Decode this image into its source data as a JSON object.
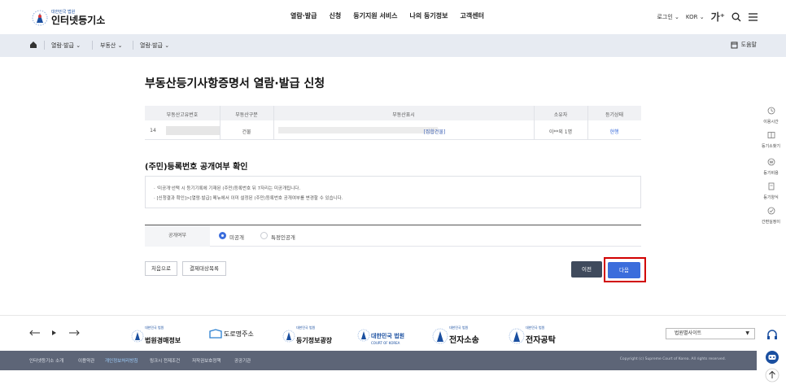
{
  "header": {
    "logo_small": "대한민국 법원",
    "logo_big": "인터넷등기소",
    "nav": [
      "열람·발급",
      "신청",
      "등기지원 서비스",
      "나의 등기정보",
      "고객센터"
    ],
    "login": "로그인",
    "lang": "KOR",
    "font_size": "가⁺"
  },
  "breadcrumb": {
    "items": [
      "열람·발급",
      "부동산",
      "열람·발급"
    ],
    "help": "도움말"
  },
  "page_title": "부동산등기사항증명서 열람·발급 신청",
  "table": {
    "headers": [
      "부동산고유번호",
      "부동산구분",
      "부동산표시",
      "소유자",
      "등기상태"
    ],
    "row": {
      "id_prefix": "14",
      "type": "건물",
      "address": "[집합건물]",
      "owner": "이**외 1명",
      "status": "현행"
    }
  },
  "section2_title": "(주민)등록번호 공개여부 확인",
  "notice": [
    "· '미공개'선택 시 등기기록에 기재된 (주민)등록번호 뒤 7자리는 미공개됩니다.",
    "· [신청결과 확인]>[열람·발급] 메뉴에서 이미 설정된 (주민)등록번호 공개여부를 변경할 수 있습니다."
  ],
  "disclosure": {
    "label": "공개여부",
    "options": [
      "미공개",
      "특정인공개"
    ],
    "selected": "미공개"
  },
  "buttons": {
    "first": "처음으로",
    "list": "결제대상목록",
    "prev": "이전",
    "next": "다음"
  },
  "quick_menu": [
    "이용시간",
    "등기소찾기",
    "등기비용",
    "등기양식",
    "간편실정이"
  ],
  "footer_links": [
    {
      "small": "대한민국 법원",
      "title": "법원경매정보"
    },
    {
      "small": "",
      "title": "도로명주소"
    },
    {
      "small": "대한민국 법원",
      "title": "등기정보광장"
    },
    {
      "small": "COURT OF KOREA",
      "title": "대한민국 법원"
    },
    {
      "small": "대한민국 법원",
      "title": "전자소송"
    },
    {
      "small": "대한민국 법원",
      "title": "전자공탁"
    }
  ],
  "footer_select": "법원별사이트",
  "footer_bar": {
    "links": [
      "인터넷등기소 소개",
      "이용약관",
      "개인정보처리방침",
      "링크시 전제조건",
      "저작권보호정책",
      "공공기관"
    ],
    "highlight_index": 2,
    "copyright": "Copyright (c) Supreme Court of Korea. All rights reserved."
  },
  "colors": {
    "primary": "#3b6ddc",
    "dark_button": "#3f4a5c",
    "highlight_border": "#d10000",
    "footer_bg": "#5d6577",
    "crumb_bg": "#e7ebf2"
  }
}
